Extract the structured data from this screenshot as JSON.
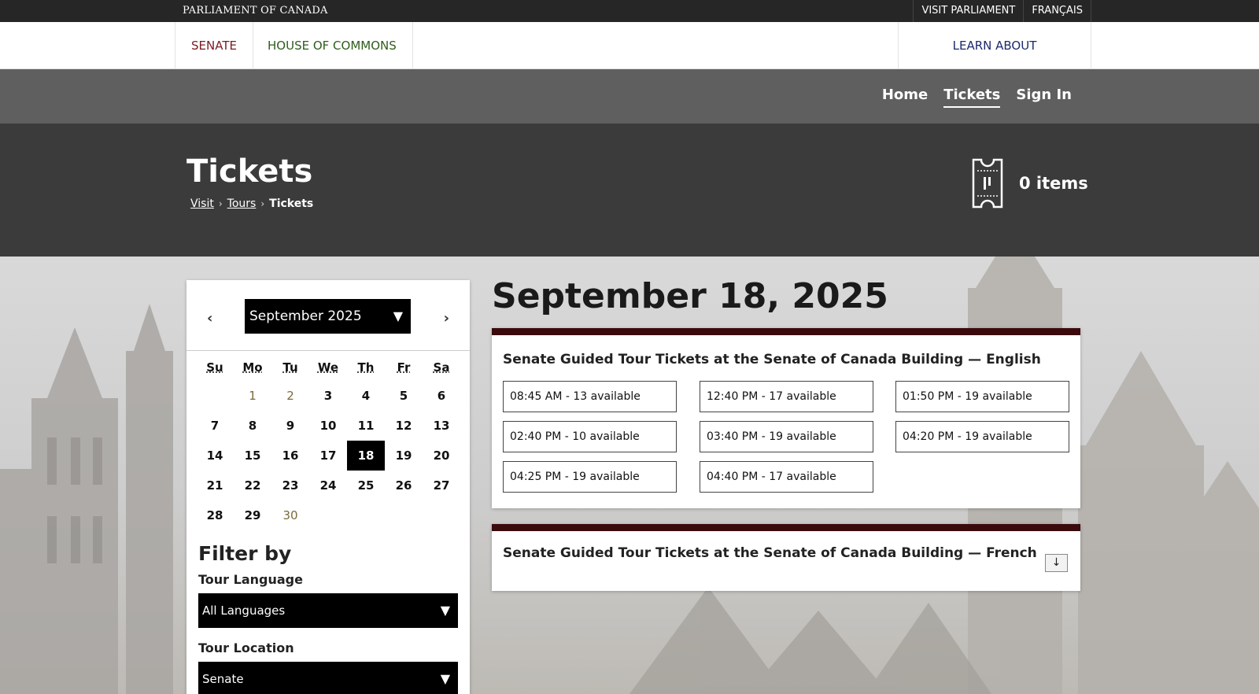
{
  "topbar": {
    "brand": "PARLIAMENT OF CANADA",
    "visit": "VISIT PARLIAMENT",
    "lang": "FRANÇAIS"
  },
  "chambers": {
    "senate": "SENATE",
    "house": "HOUSE OF COMMONS",
    "learn": "LEARN ABOUT PARLIAMENT"
  },
  "subnav": {
    "home": "Home",
    "tickets": "Tickets",
    "signin": "Sign In"
  },
  "header": {
    "title": "Tickets",
    "breadcrumb": [
      "Visit",
      "Tours",
      "Tickets"
    ],
    "cart_label": "0 items"
  },
  "calendar": {
    "month": "September 2025",
    "prev": "‹",
    "next": "›",
    "dow": [
      "Su",
      "Mo",
      "Tu",
      "We",
      "Th",
      "Fr",
      "Sa"
    ],
    "weeks": [
      [
        "",
        "1",
        "2",
        "3",
        "4",
        "5",
        "6"
      ],
      [
        "7",
        "8",
        "9",
        "10",
        "11",
        "12",
        "13"
      ],
      [
        "14",
        "15",
        "16",
        "17",
        "18",
        "19",
        "20"
      ],
      [
        "21",
        "22",
        "23",
        "24",
        "25",
        "26",
        "27"
      ],
      [
        "28",
        "29",
        "30",
        "",
        "",
        "",
        ""
      ]
    ],
    "muted_days": [
      "1",
      "2",
      "30"
    ],
    "selected_day": "18"
  },
  "filter": {
    "title": "Filter by",
    "language_label": "Tour Language",
    "language_value": "All Languages",
    "location_label": "Tour Location",
    "location_value": "Senate"
  },
  "main": {
    "date_title": "September 18, 2025",
    "english_title": "Senate Guided Tour Tickets at the Senate of Canada Building — English",
    "english_slots": [
      "08:45 AM - 13 available",
      "12:40 PM - 17 available",
      "01:50 PM - 19 available",
      "02:40 PM - 10 available",
      "03:40 PM - 19 available",
      "04:20 PM - 19 available",
      "04:25 PM - 19 available",
      "04:40 PM - 17 available"
    ],
    "french_title": "Senate Guided Tour Tickets at the Senate of Canada Building — French",
    "expand_icon": "↓"
  },
  "colors": {
    "accent": "#3a0a0c",
    "senate": "#7a1b24",
    "house": "#2e5d1a",
    "learn": "#1c2a6b"
  }
}
